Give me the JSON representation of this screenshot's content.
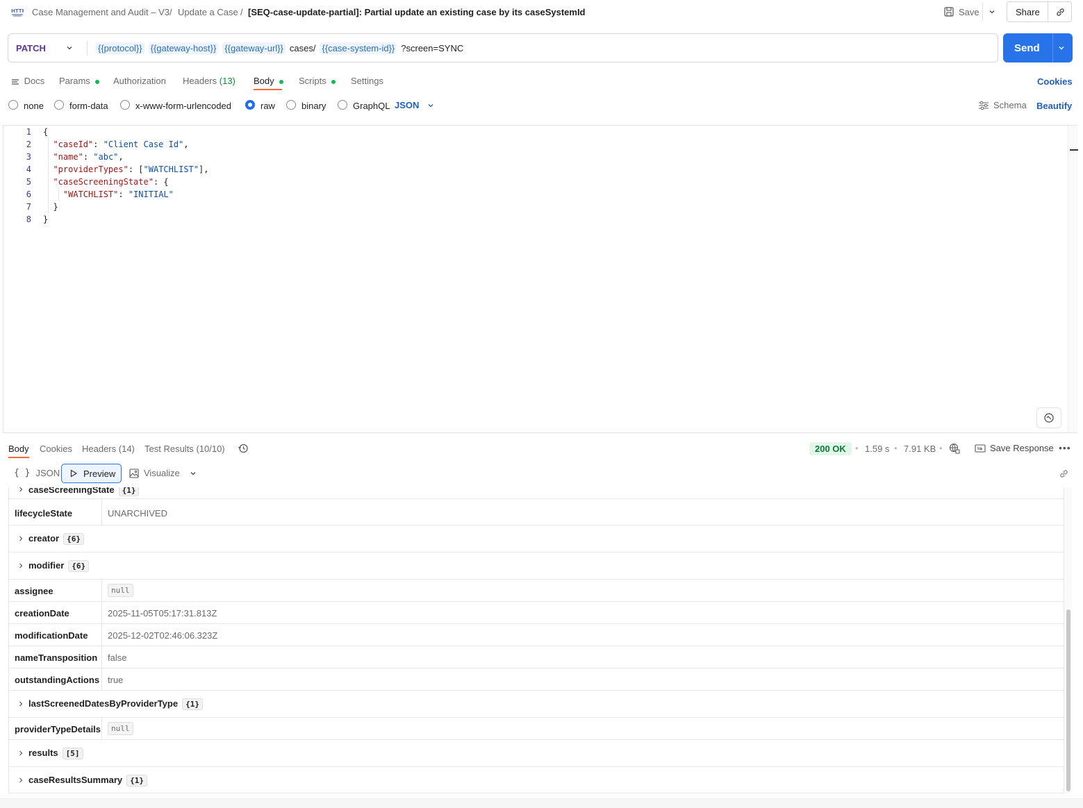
{
  "breadcrumb": {
    "collection": "Case Management and Audit – V3",
    "folder": "Update a Case",
    "separator": "/",
    "request": "[SEQ-case-update-partial]: Partial update an existing case by its caseSystemId"
  },
  "header_actions": {
    "save": "Save",
    "share": "Share"
  },
  "request": {
    "method": "PATCH",
    "url_parts": [
      {
        "type": "var",
        "text": "{{protocol}}"
      },
      {
        "type": "var",
        "text": "{{gateway-host}}"
      },
      {
        "type": "var",
        "text": "{{gateway-url}}"
      },
      {
        "type": "text",
        "text": "cases/"
      },
      {
        "type": "var",
        "text": "{{case-system-id}}"
      },
      {
        "type": "text",
        "text": "?screen=SYNC"
      }
    ],
    "send": "Send"
  },
  "request_tabs": {
    "docs": "Docs",
    "params": "Params",
    "authorization": "Authorization",
    "headers": "Headers",
    "headers_count": "(13)",
    "body": "Body",
    "scripts": "Scripts",
    "settings": "Settings",
    "cookies": "Cookies"
  },
  "body_types": {
    "none": "none",
    "form_data": "form-data",
    "urlencoded": "x-www-form-urlencoded",
    "raw": "raw",
    "binary": "binary",
    "graphql": "GraphQL",
    "selected": "raw",
    "format": "JSON",
    "schema": "Schema",
    "beautify": "Beautify"
  },
  "editor": {
    "line_numbers": [
      "1",
      "2",
      "3",
      "4",
      "5",
      "6",
      "7",
      "8"
    ]
  },
  "response": {
    "tabs": {
      "body": "Body",
      "cookies": "Cookies",
      "headers": "Headers",
      "headers_count": "(14)",
      "tests": "Test Results",
      "tests_count": "(10/10)"
    },
    "status": "200 OK",
    "time": "1.59 s",
    "size": "7.91 KB",
    "save_response": "Save Response",
    "views": {
      "json": "JSON",
      "preview": "Preview",
      "visualize": "Visualize"
    },
    "rows": [
      {
        "key": "caseScreeningState",
        "badge": "{1}",
        "expandable": true
      },
      {
        "key": "lifecycleState",
        "value": "UNARCHIVED"
      },
      {
        "key": "creator",
        "badge": "{6}",
        "expandable": true
      },
      {
        "key": "modifier",
        "badge": "{6}",
        "expandable": true
      },
      {
        "key": "assignee",
        "null_value": "null"
      },
      {
        "key": "creationDate",
        "value": "2025-11-05T05:17:31.813Z"
      },
      {
        "key": "modificationDate",
        "value": "2025-12-02T02:46:06.323Z"
      },
      {
        "key": "nameTransposition",
        "value": "false"
      },
      {
        "key": "outstandingActions",
        "value": "true"
      },
      {
        "key": "lastScreenedDatesByProviderType",
        "badge": "{1}",
        "expandable": true
      },
      {
        "key": "providerTypeDetails",
        "null_value": "null"
      },
      {
        "key": "results",
        "badge": "[5]",
        "expandable": true
      },
      {
        "key": "caseResultsSummary",
        "badge": "{1}",
        "expandable": true
      }
    ]
  }
}
